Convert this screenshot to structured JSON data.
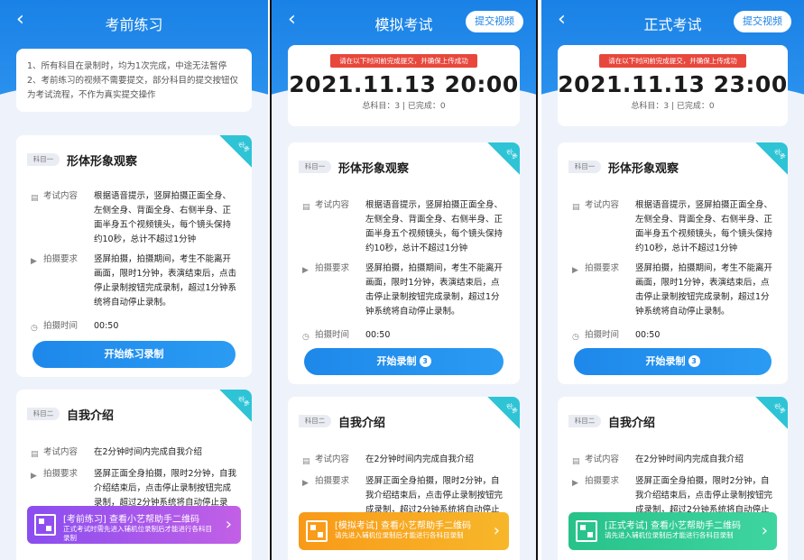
{
  "panels": [
    {
      "title": "考前练习",
      "back_icon": "chevron-left-icon",
      "notice": [
        "1、所有科目在录制时，均为1次完成，中途无法暂停",
        "2、考前练习的视频不需要提交，部分科目的提交按钮仅为考试流程，不作为真实提交操作"
      ],
      "subjects": [
        {
          "tag": "科目一",
          "title": "形体形象观察",
          "corner": "必考",
          "content_label": "考试内容",
          "content": "根据语音提示，竖屏拍摄正面全身、左侧全身、背面全身、右侧半身、正面半身五个视频镜头，每个镜头保持约10秒，总计不超过1分钟",
          "req_label": "拍摄要求",
          "req": "竖屏拍摄，拍摄期间，考生不能离开画面，限时1分钟，表演结束后，点击停止录制按钮完成录制，超过1分钟系统将自动停止录制。",
          "time_label": "拍摄时间",
          "time": "00:50",
          "button": "开始练习录制"
        },
        {
          "tag": "科目二",
          "title": "自我介绍",
          "corner": "必考",
          "content_label": "考试内容",
          "content": "在2分钟时间内完成自我介绍",
          "req_label": "拍摄要求",
          "req": "竖屏正面全身拍摄，限时2分钟，自我介绍结束后，点击停止录制按钮完成录制，超过2分钟系统将自动停止录"
        }
      ],
      "banner": {
        "title": "[考前练习] 查看小艺帮助手二维码",
        "sub": "正式考试时需先进入辅机位录制后才能进行各科目录制",
        "color": "#9a55ee"
      }
    },
    {
      "title": "模拟考试",
      "submit": "提交视频",
      "deadline_note": "请在以下时间前完成提交，并确保上传成功",
      "deadline": "2021.11.13 20:00",
      "progress": "总科目：3 | 已完成：0",
      "subjects": [
        {
          "tag": "科目一",
          "title": "形体形象观察",
          "corner": "必考",
          "content_label": "考试内容",
          "content": "根据语音提示，竖屏拍摄正面全身、左侧全身、背面全身、右侧半身、正面半身五个视频镜头，每个镜头保持约10秒，总计不超过1分钟",
          "req_label": "拍摄要求",
          "req": "竖屏拍摄，拍摄期间，考生不能离开画面，限时1分钟，表演结束后，点击停止录制按钮完成录制，超过1分钟系统将自动停止录制。",
          "time_label": "拍摄时间",
          "time": "00:50",
          "button": "开始录制",
          "button_count": "3"
        },
        {
          "tag": "科目二",
          "title": "自我介绍",
          "corner": "必考",
          "content_label": "考试内容",
          "content": "在2分钟时间内完成自我介绍",
          "req_label": "拍摄要求",
          "req": "竖屏正面全身拍摄，限时2分钟，自我介绍结束后，点击停止录制按钮完成录制，超过2分钟系统将自动停止录"
        }
      ],
      "banner": {
        "title": "[模拟考试] 查看小艺帮助手二维码",
        "sub": "请先进入辅机位录制后才能进行各科目录制",
        "color": "#f89a18"
      }
    },
    {
      "title": "正式考试",
      "submit": "提交视频",
      "deadline_note": "请在以下时间前完成提交，并确保上传成功",
      "deadline": "2021.11.13 23:00",
      "progress": "总科目：3 | 已完成：0",
      "subjects": [
        {
          "tag": "科目一",
          "title": "形体形象观察",
          "corner": "必考",
          "content_label": "考试内容",
          "content": "根据语音提示，竖屏拍摄正面全身、左侧全身、背面全身、右侧半身、正面半身五个视频镜头，每个镜头保持约10秒，总计不超过1分钟",
          "req_label": "拍摄要求",
          "req": "竖屏拍摄，拍摄期间，考生不能离开画面，限时1分钟，表演结束后，点击停止录制按钮完成录制，超过1分钟系统将自动停止录制。",
          "time_label": "拍摄时间",
          "time": "00:50",
          "button": "开始录制",
          "button_count": "3"
        },
        {
          "tag": "科目二",
          "title": "自我介绍",
          "corner": "必考",
          "content_label": "考试内容",
          "content": "在2分钟时间内完成自我介绍",
          "req_label": "拍摄要求",
          "req": "竖屏正面全身拍摄，限时2分钟，自我介绍结束后，点击停止录制按钮完成录制，超过2分钟系统将自动停止录"
        }
      ],
      "banner": {
        "title": "[正式考试] 查看小艺帮助手二维码",
        "sub": "请先进入辅机位录制后才能进行各科目录制",
        "color": "#27c28a"
      }
    }
  ],
  "icons": {
    "back": "chevron-left-icon",
    "doc": "document-icon",
    "camera": "video-camera-icon",
    "clock": "clock-icon",
    "qr": "qr-code-icon",
    "arrow": "chevron-right-icon"
  }
}
